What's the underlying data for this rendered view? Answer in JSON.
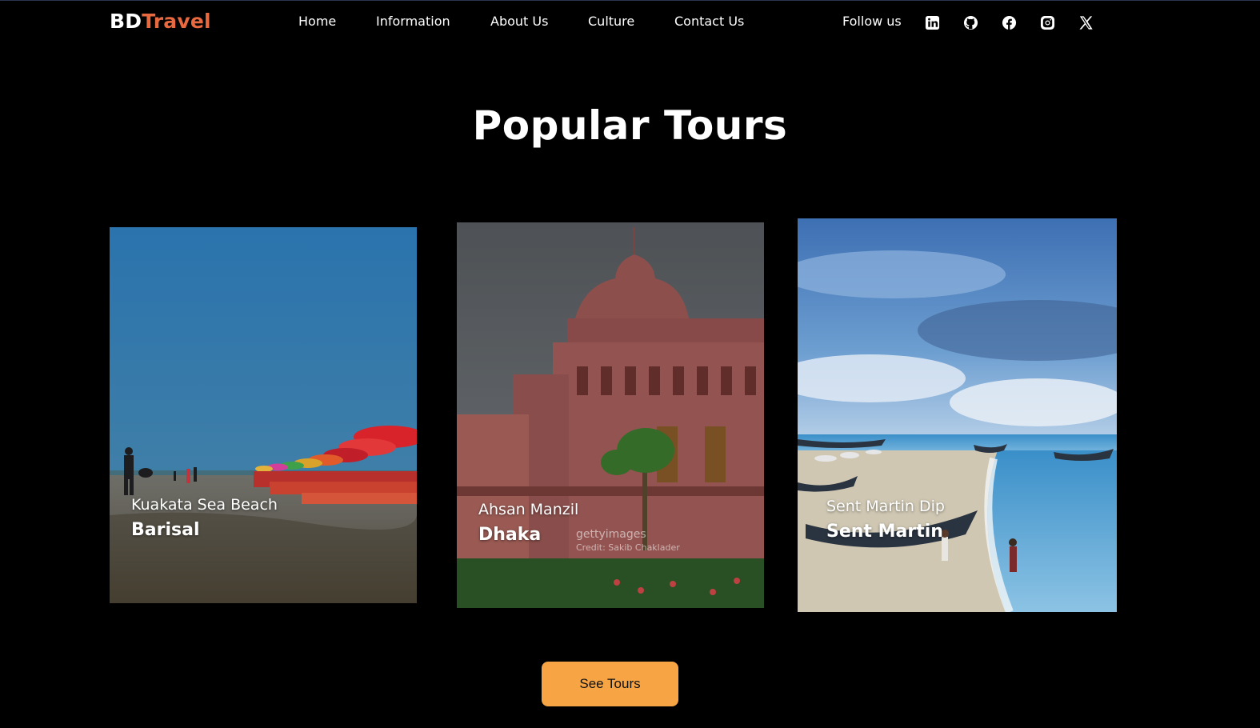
{
  "header": {
    "logo_part1": "BD",
    "logo_part2": "Travel",
    "nav": [
      "Home",
      "Information",
      "About Us",
      "Culture",
      "Contact Us"
    ],
    "follow_label": "Follow us",
    "social_icons": [
      "linkedin-icon",
      "github-icon",
      "facebook-icon",
      "instagram-icon",
      "x-icon"
    ]
  },
  "section": {
    "title": "Popular Tours",
    "cards": [
      {
        "place": "Kuakata Sea Beach",
        "city": "Barisal"
      },
      {
        "place": "Ahsan Manzil",
        "city": "Dhaka",
        "watermark": "gettyimages",
        "credit": "Credit: Sakib Chaklader"
      },
      {
        "place": "Sent Martin Dip",
        "city": "Sent Martin"
      }
    ],
    "button_label": "See Tours"
  },
  "colors": {
    "background": "#000000",
    "logo_accent": "#e8693f",
    "button": "#f7a444"
  }
}
